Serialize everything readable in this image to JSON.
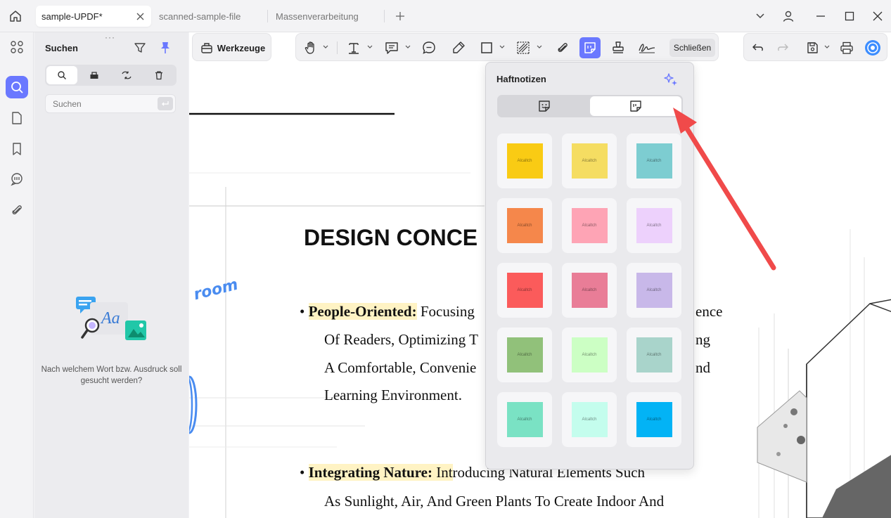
{
  "tabs": [
    {
      "label": "sample-UPDF*",
      "active": true
    },
    {
      "label": "scanned-sample-file",
      "active": false
    },
    {
      "label": "Massenverarbeitung",
      "active": false
    }
  ],
  "search_panel": {
    "title": "Suchen",
    "placeholder": "Suchen",
    "empty_message": "Nach welchem Wort bzw. Ausdruck soll gesucht werden?",
    "illustration_text": "Aa"
  },
  "toolbar": {
    "tools_label": "Werkzeuge",
    "close_label": "Schließen"
  },
  "popup": {
    "title": "Haftnotizen",
    "notes": [
      {
        "color": "#F9CB14",
        "label": "Alcaltch"
      },
      {
        "color": "#F5DD62",
        "label": "Alcaltch"
      },
      {
        "color": "#7DCDD1",
        "label": "Alcaltch"
      },
      {
        "color": "#F5874B",
        "label": "Alcaltch"
      },
      {
        "color": "#FEA4B5",
        "label": "Alcaltch"
      },
      {
        "color": "#EDD1FC",
        "label": "Alcaltch"
      },
      {
        "color": "#FB5B5B",
        "label": "Alcaltch"
      },
      {
        "color": "#E97D97",
        "label": "Alcaltch"
      },
      {
        "color": "#C8B8E9",
        "label": "Alcaltch"
      },
      {
        "color": "#91C17A",
        "label": "Alcaltch"
      },
      {
        "color": "#CCFFC4",
        "label": "Alcaltch"
      },
      {
        "color": "#A9D4CB",
        "label": "Alcaltch"
      },
      {
        "color": "#7AE2C4",
        "label": "Alcaltch"
      },
      {
        "color": "#C4FDED",
        "label": "Alcaltch"
      },
      {
        "color": "#03B3F5",
        "label": "Alcaltch"
      }
    ]
  },
  "document": {
    "title": "DESIGN CONCE",
    "decor_word": "room",
    "bullets": [
      {
        "bold": "People-Oriented:",
        "rest": " Focusing",
        "lines": [
          "Of Readers, Optimizing T",
          "A Comfortable, Convenie",
          "Learning Environment."
        ],
        "right_fragments": [
          "ence",
          "ng",
          "nd"
        ]
      },
      {
        "bold": "Integrating Nature:",
        "hl_tail": " Int",
        "rest": "roducing Natural Elements Such",
        "lines": [
          "As Sunlight, Air, And Green Plants To Create Indoor And"
        ]
      }
    ]
  },
  "colors": {
    "accent": "#6A78FF",
    "arrow": "#F04A4A",
    "highlight": "#FFF3C4"
  }
}
